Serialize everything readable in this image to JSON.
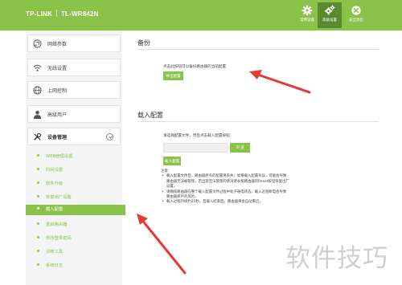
{
  "header": {
    "brand": "TP-LINK",
    "model": "TL-WR842N",
    "buttons": [
      {
        "label": "常用设置",
        "icon": "gear-icon"
      },
      {
        "label": "高级设置",
        "icon": "gears-icon"
      },
      {
        "label": "安全退出",
        "icon": "close-icon"
      }
    ]
  },
  "sidebar": {
    "items": [
      {
        "label": "网络参数",
        "icon": "network-icon"
      },
      {
        "label": "无线设置",
        "icon": "wifi-icon"
      },
      {
        "label": "上网控制",
        "icon": "globe-icon"
      },
      {
        "label": "高级用户",
        "icon": "user-icon"
      },
      {
        "label": "设备管理",
        "icon": "tools-icon"
      }
    ],
    "subitems": [
      "WEB管理设置",
      "时间设置",
      "软件升级",
      "恢复出厂设置",
      "载入配置",
      "重启路由器",
      "修改登录密码",
      "诊断工具",
      "系统日志"
    ],
    "active_index": 4
  },
  "backup": {
    "title": "备份",
    "desc": "点击此按钮可以备份路由器的当前配置",
    "button": "导出配置"
  },
  "load": {
    "title": "载入配置",
    "desc": "请选择配置文件，然后点击载入配置按钮",
    "browse": "浏 览",
    "button": "载入配置",
    "notes_title": "注意：",
    "notes": [
      "载入配置文件后，路由器原有的配置将丢失；如果载入配置有误，可能会导致路由器无法被管理，若出现无法管理的情况请长按路由器的Reset按钮恢复出厂设置。",
      "请确保路由器在整个载入配置文件过程中处于通电状态，载入过程断电会导致路由器损坏的风险。",
      "载入过程持续约20秒，且载入结束后，路由器将会自动重启。"
    ]
  },
  "watermark": "软件技巧",
  "colors": {
    "accent": "#8bc34a",
    "annotation": "#e53935"
  }
}
